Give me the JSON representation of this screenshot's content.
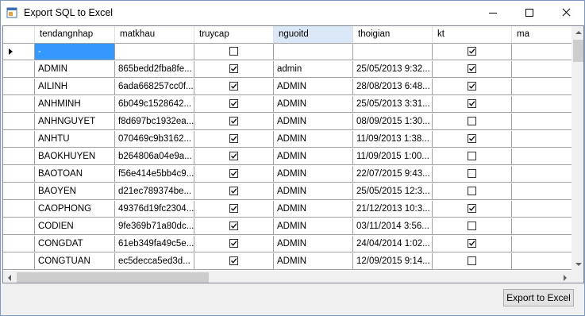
{
  "window": {
    "title": "Export SQL to Excel",
    "icon": "app-window-icon",
    "controls": [
      "minimize-icon",
      "maximize-icon",
      "close-icon"
    ]
  },
  "grid": {
    "columns": [
      "tendangnhap",
      "matkhau",
      "truycap",
      "nguoitd",
      "thoigian",
      "kt",
      "ma"
    ],
    "selected_column": "nguoitd",
    "new_row": {
      "tendangnhap": "-",
      "truycap": false,
      "kt": true
    },
    "rows": [
      {
        "tendangnhap": "ADMIN",
        "matkhau": "865bedd2fba8fe...",
        "truycap": true,
        "nguoitd": "admin",
        "thoigian": "25/05/2013 9:32...",
        "kt": true
      },
      {
        "tendangnhap": "AILINH",
        "matkhau": "6ada668257cc0f...",
        "truycap": true,
        "nguoitd": "ADMIN",
        "thoigian": "28/08/2013 6:48...",
        "kt": true
      },
      {
        "tendangnhap": "ANHMINH",
        "matkhau": "6b049c1528642...",
        "truycap": true,
        "nguoitd": "ADMIN",
        "thoigian": "25/05/2013 3:31...",
        "kt": true
      },
      {
        "tendangnhap": "ANHNGUYET",
        "matkhau": "f8d697bc1932ea...",
        "truycap": true,
        "nguoitd": "ADMIN",
        "thoigian": "08/09/2015 1:30...",
        "kt": false
      },
      {
        "tendangnhap": "ANHTU",
        "matkhau": "070469c9b3162...",
        "truycap": true,
        "nguoitd": "ADMIN",
        "thoigian": "11/09/2013 1:38...",
        "kt": true
      },
      {
        "tendangnhap": "BAOKHUYEN",
        "matkhau": "b264806a04e9a...",
        "truycap": true,
        "nguoitd": "ADMIN",
        "thoigian": "11/09/2015 1:00...",
        "kt": false
      },
      {
        "tendangnhap": "BAOTOAN",
        "matkhau": "f56e414e5bb4c9...",
        "truycap": true,
        "nguoitd": "ADMIN",
        "thoigian": "22/07/2015 9:43...",
        "kt": false
      },
      {
        "tendangnhap": "BAOYEN",
        "matkhau": "d21ec789374be...",
        "truycap": true,
        "nguoitd": "ADMIN",
        "thoigian": "25/05/2015 12:3...",
        "kt": false
      },
      {
        "tendangnhap": "CAOPHONG",
        "matkhau": "49376d19fc2304...",
        "truycap": true,
        "nguoitd": "ADMIN",
        "thoigian": "21/12/2013 10:3...",
        "kt": true
      },
      {
        "tendangnhap": "CODIEN",
        "matkhau": "9fe369b71a80dc...",
        "truycap": true,
        "nguoitd": "ADMIN",
        "thoigian": "03/11/2014 3:56...",
        "kt": false
      },
      {
        "tendangnhap": "CONGDAT",
        "matkhau": "61eb349fa49c5e...",
        "truycap": true,
        "nguoitd": "ADMIN",
        "thoigian": "24/04/2014 1:02...",
        "kt": true
      },
      {
        "tendangnhap": "CONGTUAN",
        "matkhau": "ec5decca5ed3d...",
        "truycap": true,
        "nguoitd": "ADMIN",
        "thoigian": "12/09/2015 9:14...",
        "kt": false
      }
    ]
  },
  "footer": {
    "export_label": "Export to Excel"
  },
  "colors": {
    "selection": "#3399ff",
    "header_selected": "#dbe8f8",
    "grid_line": "#a0a0a0"
  }
}
